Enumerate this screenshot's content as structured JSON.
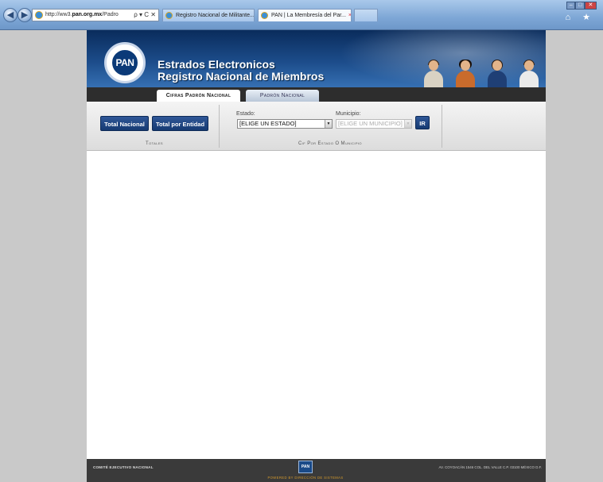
{
  "browser": {
    "address": {
      "prefix": "http://ww3.",
      "domain": "pan.org.mx",
      "suffix": "/Padro",
      "tools": "ρ ▾ C ✕"
    },
    "tabs": [
      {
        "label": "Registro Nacional de Militante..."
      },
      {
        "label": "PAN | La Membresía del Par...",
        "close": "×"
      },
      {
        "label": ""
      }
    ],
    "window_buttons": [
      "–",
      "□",
      "✕"
    ],
    "right_icons": "⌂ ★"
  },
  "header": {
    "logo_text": "PAN",
    "title_line1": "Estrados Electronicos",
    "title_line2": "Registro Nacional de Miembros"
  },
  "page_tabs": {
    "active": "Cifras Padrón Nacional",
    "inactive": "Padrón Nacional"
  },
  "toolbar": {
    "total_nacional": "Total Nacional",
    "total_por_entidad": "Total por Entidad",
    "totales_label": "Totales",
    "estado_label": "Estado:",
    "estado_value": "[ELIGE UN ESTADO]",
    "municipio_label": "Municipio:",
    "municipio_value": "[ELIGE UN MUNICIPIO]",
    "ir_button": "IR",
    "cif_label": "Cif Por Estado O Municipio"
  },
  "footer": {
    "left": "COMITÉ EJECUTIVO NACIONAL",
    "logo_text": "PAN",
    "powered": "POWERED BY DIRECCIÓN DE SISTEMAS",
    "right": "AV. COYOACÁN 1546 COL. DEL VALLE C.P. 03100 MÉXICO D.F."
  },
  "colors": {
    "header_blue": "#1c4c8a",
    "button_blue": "#163a72",
    "footer_dark": "#3a3a3a",
    "footer_accent": "#d59a2c"
  }
}
